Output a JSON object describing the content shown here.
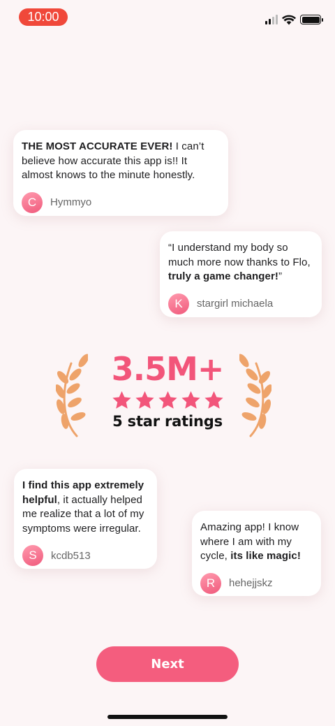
{
  "status_bar": {
    "time": "10:00"
  },
  "reviews": [
    {
      "bold_prefix": "THE MOST ACCURATE EVER!",
      "text": " I can’t believe how accurate this app is!! It almost knows to the minute honestly.",
      "bold_suffix": "",
      "text_after": "",
      "avatar_letter": "C",
      "author": "Hymmyo"
    },
    {
      "bold_prefix": "",
      "text": "“I understand my body so much more now thanks to Flo, ",
      "bold_suffix": "truly a game changer!",
      "text_after": "”",
      "avatar_letter": "K",
      "author": "stargirl michaela"
    },
    {
      "bold_prefix": "I find this app extremely helpful",
      "text": ", it actually helped me realize that a lot of my symptoms were irregular.",
      "bold_suffix": "",
      "text_after": "",
      "avatar_letter": "S",
      "author": "kcdb513"
    },
    {
      "bold_prefix": "",
      "text": "Amazing app! I know where I am with my cycle, ",
      "bold_suffix": "its like magic!",
      "text_after": "",
      "avatar_letter": "R",
      "author": "hehejjskz"
    }
  ],
  "rating": {
    "count": "3.5M+",
    "stars": 5,
    "label": "5 star ratings"
  },
  "next_button": {
    "label": "Next"
  },
  "colors": {
    "accent": "#f45d7e",
    "rating_pink": "#f2557a",
    "laurel": "#eea36a",
    "time_pill": "#f0483a",
    "background": "#fcf5f6"
  },
  "icons": [
    "signal-icon",
    "wifi-icon",
    "battery-icon",
    "star-icon",
    "laurel-icon"
  ]
}
